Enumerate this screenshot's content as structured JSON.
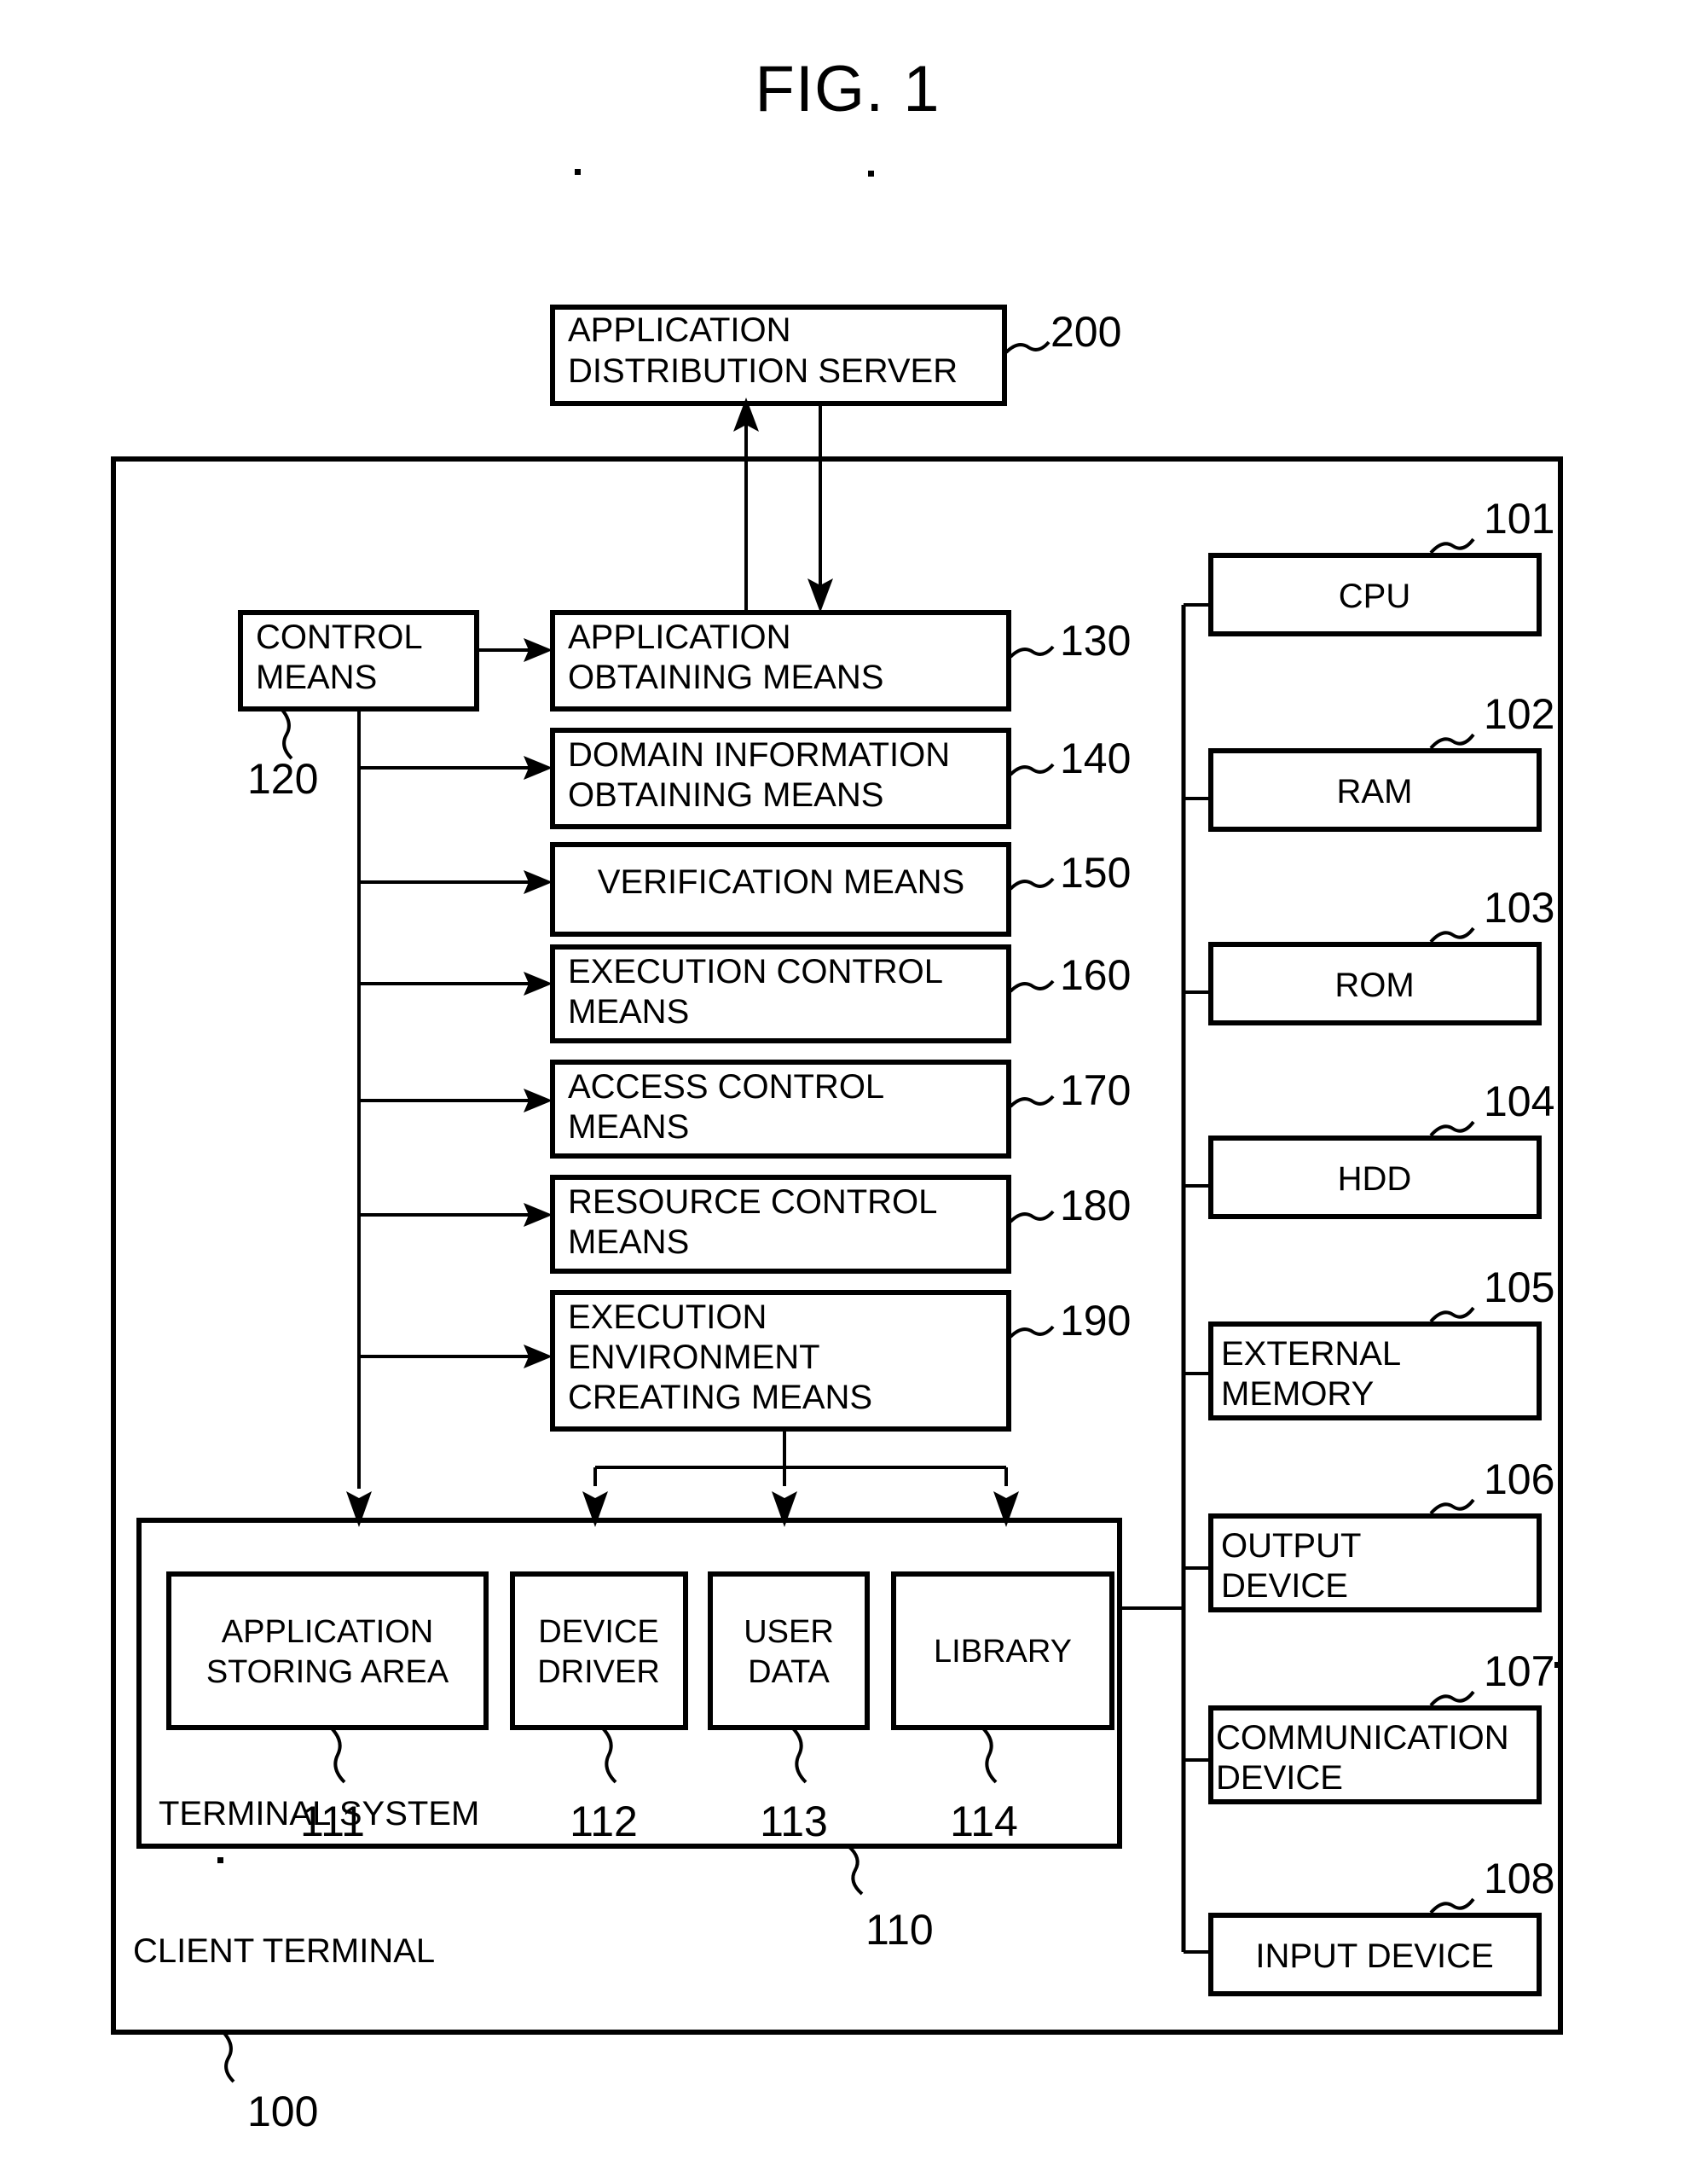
{
  "figure": {
    "title": "FIG. 1",
    "type": "patent-block-diagram"
  },
  "server": {
    "line1": "APPLICATION",
    "line2": "DISTRIBUTION SERVER",
    "ref": "200"
  },
  "client_terminal": {
    "label": "CLIENT TERMINAL",
    "ref": "100"
  },
  "control_means": {
    "line1": "CONTROL",
    "line2": "MEANS",
    "ref": "120"
  },
  "means_blocks": [
    {
      "line1": "APPLICATION",
      "line2": "OBTAINING MEANS",
      "line3": "",
      "ref": "130"
    },
    {
      "line1": "DOMAIN INFORMATION",
      "line2": "OBTAINING MEANS",
      "line3": "",
      "ref": "140"
    },
    {
      "line1": "VERIFICATION MEANS",
      "line2": "",
      "line3": "",
      "ref": "150"
    },
    {
      "line1": "EXECUTION CONTROL",
      "line2": "MEANS",
      "line3": "",
      "ref": "160"
    },
    {
      "line1": "ACCESS CONTROL",
      "line2": "MEANS",
      "line3": "",
      "ref": "170"
    },
    {
      "line1": "RESOURCE CONTROL",
      "line2": "MEANS",
      "line3": "",
      "ref": "180"
    },
    {
      "line1": "EXECUTION",
      "line2": "ENVIRONMENT",
      "line3": "CREATING MEANS",
      "ref": "190"
    }
  ],
  "hardware_blocks": [
    {
      "line1": "CPU",
      "line2": "",
      "ref": "101"
    },
    {
      "line1": "RAM",
      "line2": "",
      "ref": "102"
    },
    {
      "line1": "ROM",
      "line2": "",
      "ref": "103"
    },
    {
      "line1": "HDD",
      "line2": "",
      "ref": "104"
    },
    {
      "line1": "EXTERNAL",
      "line2": "MEMORY",
      "ref": "105"
    },
    {
      "line1": "OUTPUT",
      "line2": "DEVICE",
      "ref": "106"
    },
    {
      "line1": "COMMUNICATION",
      "line2": "DEVICE",
      "ref": "107"
    },
    {
      "line1": "INPUT DEVICE",
      "line2": "",
      "ref": "108"
    }
  ],
  "terminal_system": {
    "label": "TERMINAL SYSTEM",
    "ref": "110",
    "items": [
      {
        "line1": "APPLICATION",
        "line2": "STORING AREA",
        "ref": "111"
      },
      {
        "line1": "DEVICE",
        "line2": "DRIVER",
        "ref": "112"
      },
      {
        "line1": "USER",
        "line2": "DATA",
        "ref": "113"
      },
      {
        "line1": "LIBRARY",
        "line2": "",
        "ref": "114"
      }
    ]
  },
  "colors": {
    "ink": "#000000",
    "paper": "#ffffff"
  }
}
